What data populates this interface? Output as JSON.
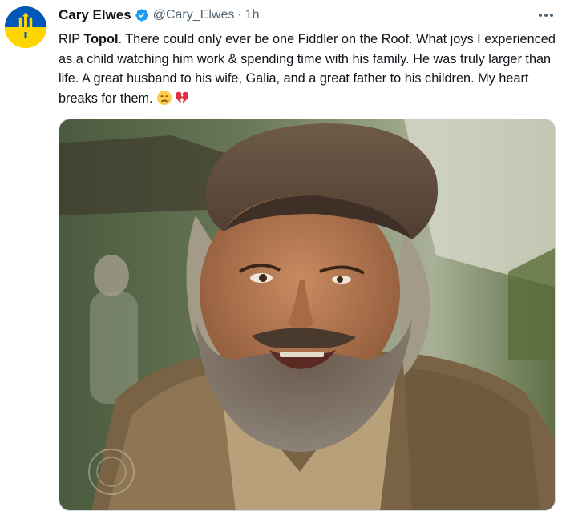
{
  "tweet": {
    "author": {
      "display_name": "Cary Elwes",
      "handle": "@Cary_Elwes",
      "avatar_icon": "ukraine-flag-trident-avatar",
      "verified_icon": "verified-badge-icon",
      "verified_color": "#1d9bf0"
    },
    "separator": "·",
    "time": "1h",
    "more_icon": "more-horizontal-icon",
    "text": {
      "prefix": "RIP ",
      "bold_name": "Topol",
      "rest": ". There could only ever be one Fiddler on the Roof. What joys I experienced as a child watching him work & spending time with his family. He was truly larger than life. A great husband to his wife, Galia, and a great father to his children. My heart breaks for them. ",
      "emojis": [
        "crying-face-emoji",
        "broken-heart-emoji"
      ]
    },
    "media": {
      "kind": "photo",
      "subject_icon": "bearded-man-in-flat-cap-photo"
    }
  },
  "colors": {
    "text_primary": "#0f1419",
    "text_secondary": "#536471",
    "accent": "#1d9bf0",
    "flag_blue": "#0057b7",
    "flag_yellow": "#ffd500"
  }
}
